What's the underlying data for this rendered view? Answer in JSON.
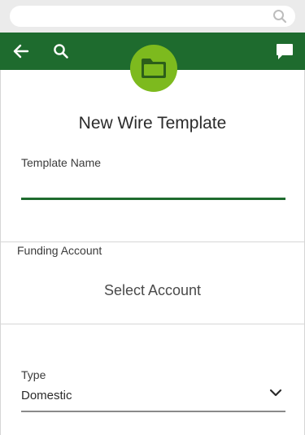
{
  "colors": {
    "brand_green": "#1e6b2e",
    "badge_green": "#7dba1e",
    "white": "#ffffff"
  },
  "browser": {
    "search_icon": "search-icon"
  },
  "header": {
    "back_icon": "back-arrow-icon",
    "search_icon": "search-icon",
    "chat_icon": "chat-bubble-icon",
    "badge_icon": "folder-icon"
  },
  "form": {
    "title": "New Wire Template",
    "template_name": {
      "label": "Template Name",
      "value": ""
    },
    "funding_account": {
      "label": "Funding Account",
      "action": "Select Account"
    },
    "type": {
      "label": "Type",
      "value": "Domestic",
      "icon": "chevron-down-icon"
    }
  }
}
